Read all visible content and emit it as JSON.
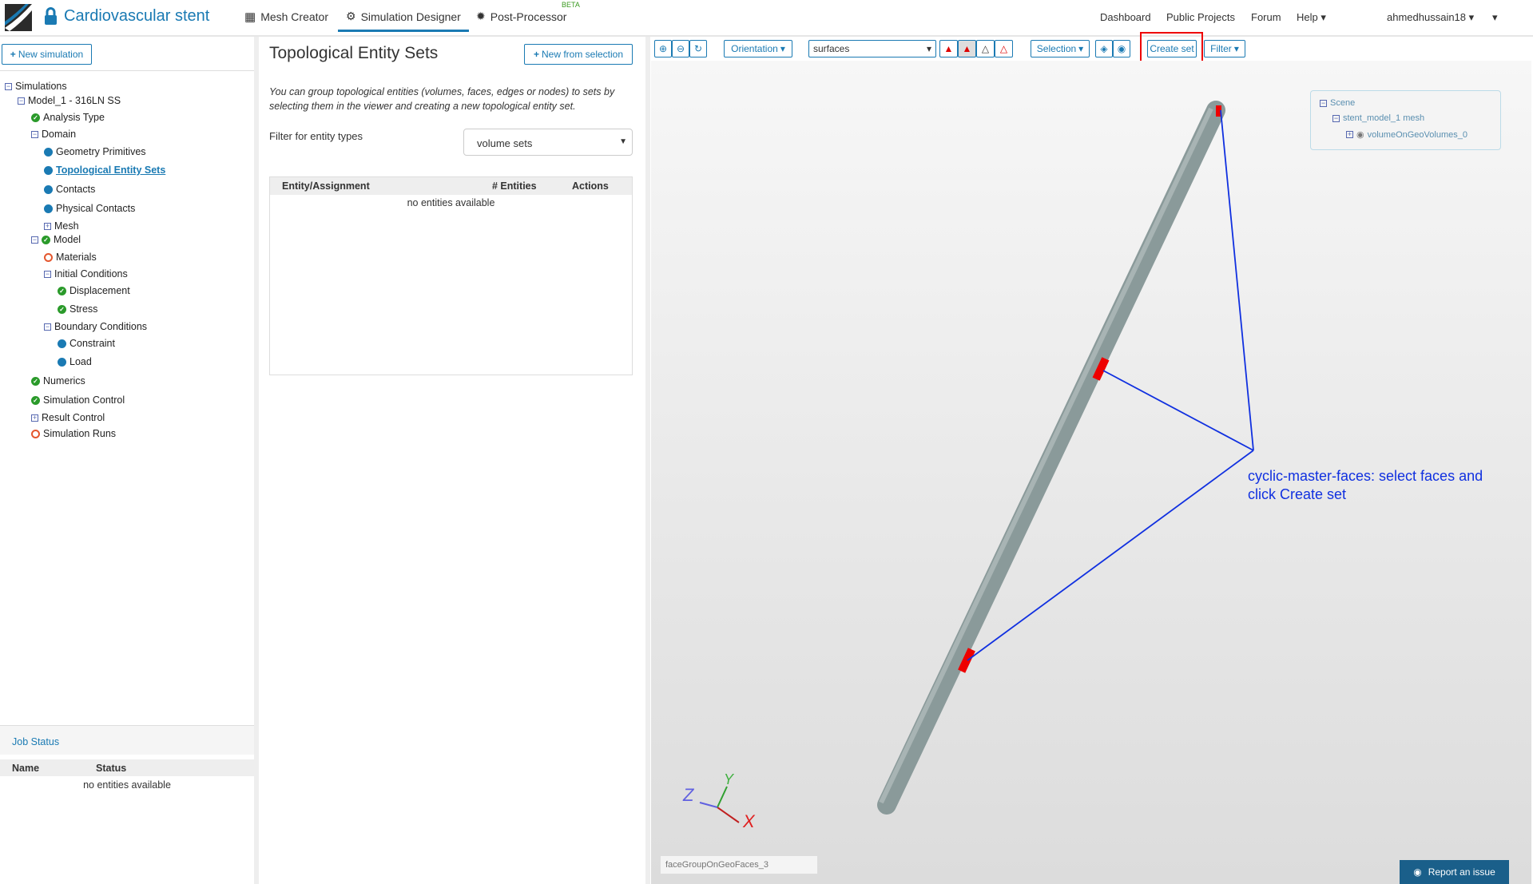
{
  "header": {
    "title": "Cardiovascular stent",
    "tabs": [
      {
        "label": "Mesh Creator"
      },
      {
        "label": "Simulation Designer"
      },
      {
        "label": "Post-Processor"
      }
    ],
    "beta": "BETA",
    "links": [
      "Dashboard",
      "Public Projects",
      "Forum",
      "Help"
    ],
    "user": "ahmedhussain18"
  },
  "left": {
    "new_simulation": "New simulation",
    "tree": [
      "Simulations",
      "Model_1 - 316LN SS",
      "Analysis Type",
      "Domain",
      "Geometry Primitives",
      "Topological Entity Sets",
      "Contacts",
      "Physical Contacts",
      "Mesh",
      "Model",
      "Materials",
      "Initial Conditions",
      "Displacement",
      "Stress",
      "Boundary Conditions",
      "Constraint",
      "Load",
      "Numerics",
      "Simulation Control",
      "Result Control",
      "Simulation Runs"
    ],
    "job_status": {
      "title": "Job Status",
      "columns": [
        "Name",
        "Status"
      ],
      "empty": "no entities available"
    }
  },
  "middle": {
    "title": "Topological Entity Sets",
    "new_from_selection": "New from selection",
    "description": "You can group topological entities (volumes, faces, edges or nodes) to sets by selecting them in the viewer and creating a new topological entity set.",
    "filter_label": "Filter for entity types",
    "filter_value": "volume sets",
    "columns": [
      "Entity/Assignment",
      "# Entities",
      "Actions"
    ],
    "empty": "no entities available"
  },
  "viewer": {
    "orientation": "Orientation",
    "render_mode": "surfaces",
    "selection": "Selection",
    "create_set": "Create set",
    "filter": "Filter",
    "scene": [
      "Scene",
      "stent_model_1 mesh",
      "volumeOnGeoVolumes_0"
    ],
    "annotation": "cyclic-master-faces: select faces and click Create set",
    "axes": {
      "x": "X",
      "y": "Y",
      "z": "Z"
    },
    "name_input_placeholder": "faceGroupOnGeoFaces_3",
    "report": "Report an issue",
    "colors": {
      "annotation": "#1030e0",
      "highlight": "#e00000",
      "rod": "#8a9a9a"
    }
  }
}
